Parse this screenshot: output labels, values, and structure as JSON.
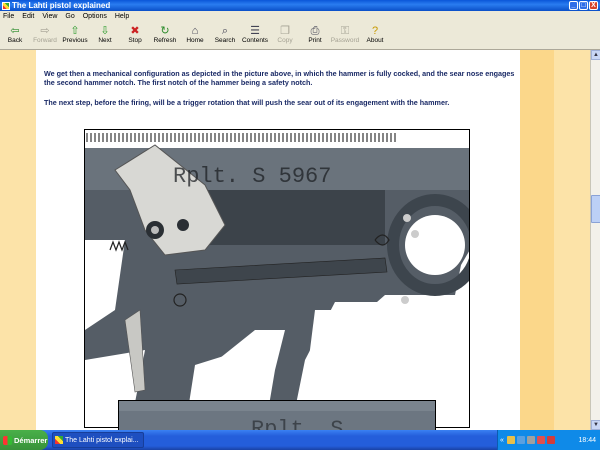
{
  "window": {
    "title": "The Lahti pistol explained",
    "controls": [
      "_",
      "□",
      "X"
    ]
  },
  "menu": [
    "File",
    "Edit",
    "View",
    "Go",
    "Options",
    "Help"
  ],
  "toolbar": [
    {
      "label": "Back",
      "icon": "⇦",
      "color": "#2a8a2a",
      "enabled": true
    },
    {
      "label": "Forward",
      "icon": "⇨",
      "color": "#a5a294",
      "enabled": false
    },
    {
      "label": "Previous",
      "icon": "⇧",
      "color": "#2a9a2a",
      "enabled": true
    },
    {
      "label": "Next",
      "icon": "⇩",
      "color": "#2a9a2a",
      "enabled": true
    },
    {
      "label": "Stop",
      "icon": "✖",
      "color": "#cc2222",
      "enabled": true
    },
    {
      "label": "Refresh",
      "icon": "↻",
      "color": "#2a8a2a",
      "enabled": true
    },
    {
      "label": "Home",
      "icon": "⌂",
      "color": "#445",
      "enabled": true
    },
    {
      "label": "Search",
      "icon": "⌕",
      "color": "#445",
      "enabled": true
    },
    {
      "label": "Contents",
      "icon": "☰",
      "color": "#445",
      "enabled": true
    },
    {
      "label": "Copy",
      "icon": "❐",
      "color": "#a5a294",
      "enabled": false
    },
    {
      "label": "Print",
      "icon": "⎙",
      "color": "#445",
      "enabled": true
    },
    {
      "label": "Password",
      "icon": "⚿",
      "color": "#a5a294",
      "enabled": false
    },
    {
      "label": "About",
      "icon": "?",
      "color": "#c79a00",
      "enabled": true
    }
  ],
  "content": {
    "paragraph1": "We get then a mechanical configuration as depicted in the picture above, in which the hammer is fully cocked, and the sear nose engages the second hammer notch. The first notch of the hammer being a safety notch.",
    "paragraph2": "The next step, before the firing, will be a trigger rotation that will push the sear out of its engagement with the hammer.",
    "photo1_engraving": "Rplt. S 5967",
    "photo2_engraving": "Rplt. S"
  },
  "taskbar": {
    "start_label": "Démarrer",
    "task_label": "The Lahti pistol explai...",
    "tray_text": "«",
    "clock": "18:44"
  }
}
